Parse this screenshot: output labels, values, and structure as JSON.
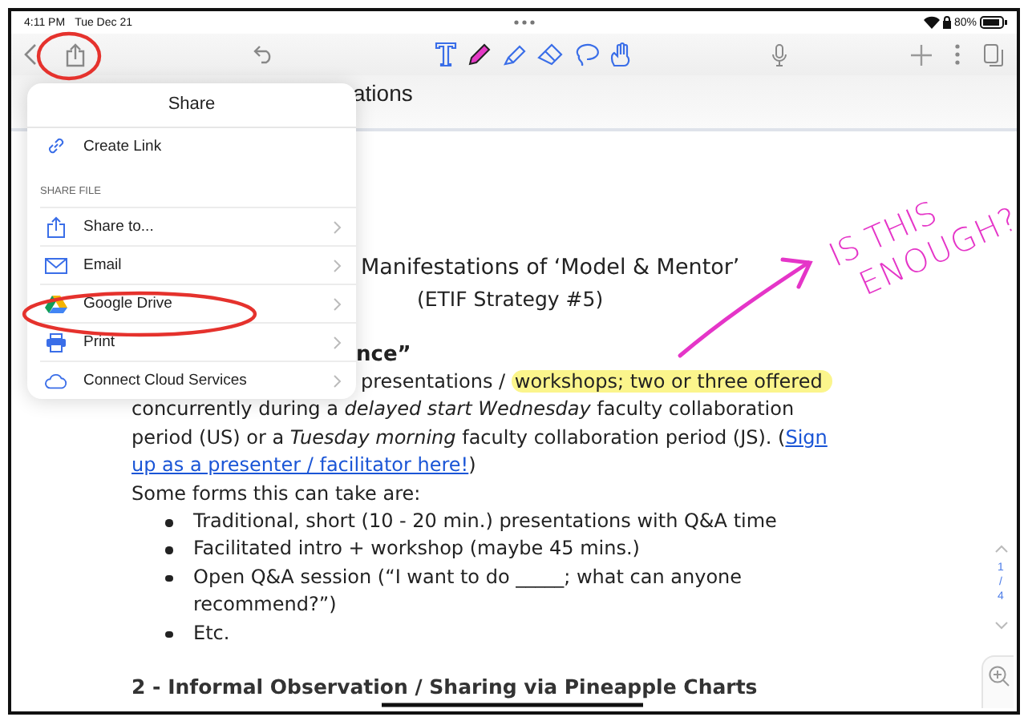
{
  "status_bar": {
    "time": "4:11 PM",
    "date": "Tue Dec 21",
    "battery": "80%"
  },
  "document": {
    "title": "ations",
    "heading": "Manifestations of ‘Model & Mentor’",
    "subheading": "(ETIF Strategy #5)",
    "section_fragment": "nce”",
    "intro_line": {
      "text": "presentations / ",
      "highlighted": "workshops; two or three offered"
    },
    "paragraph_lines": [
      {
        "text": "concurrently during a *delayed start Wednesday* faculty collaboration"
      },
      {
        "text": "period (US) or a *Tuesday morning* faculty collaboration period (JS). (",
        "link": "Sign"
      },
      {
        "link": "up as a presenter / facilitator here!",
        "after": ")"
      }
    ],
    "list_intro": "Some forms this can take are:",
    "bullets": [
      "Traditional, short (10 - 20 min.) presentations with Q&A time",
      "Facilitated intro + workshop (maybe 45 mins.)",
      "Open Q&A session (“I want to do _____; what can anyone recommend?”)",
      "Etc."
    ],
    "section_heading": "2 - Informal Observation / Sharing via Pineapple Charts"
  },
  "page_indicator": {
    "current": "1",
    "separator": "/",
    "total": "4"
  },
  "share_menu": {
    "title": "Share",
    "top_items": [
      {
        "label": "Create Link",
        "kind": "link"
      }
    ],
    "section": "SHARE FILE",
    "items": [
      {
        "label": "Share to...",
        "kind": "share"
      },
      {
        "label": "Email",
        "kind": "email"
      },
      {
        "label": "Google Drive",
        "kind": "drive"
      },
      {
        "label": "Print",
        "kind": "print"
      },
      {
        "label": "Connect Cloud Services",
        "kind": "cloud"
      }
    ]
  },
  "annotation": {
    "lines": [
      "IS THIS",
      "ENOUGH?"
    ]
  }
}
